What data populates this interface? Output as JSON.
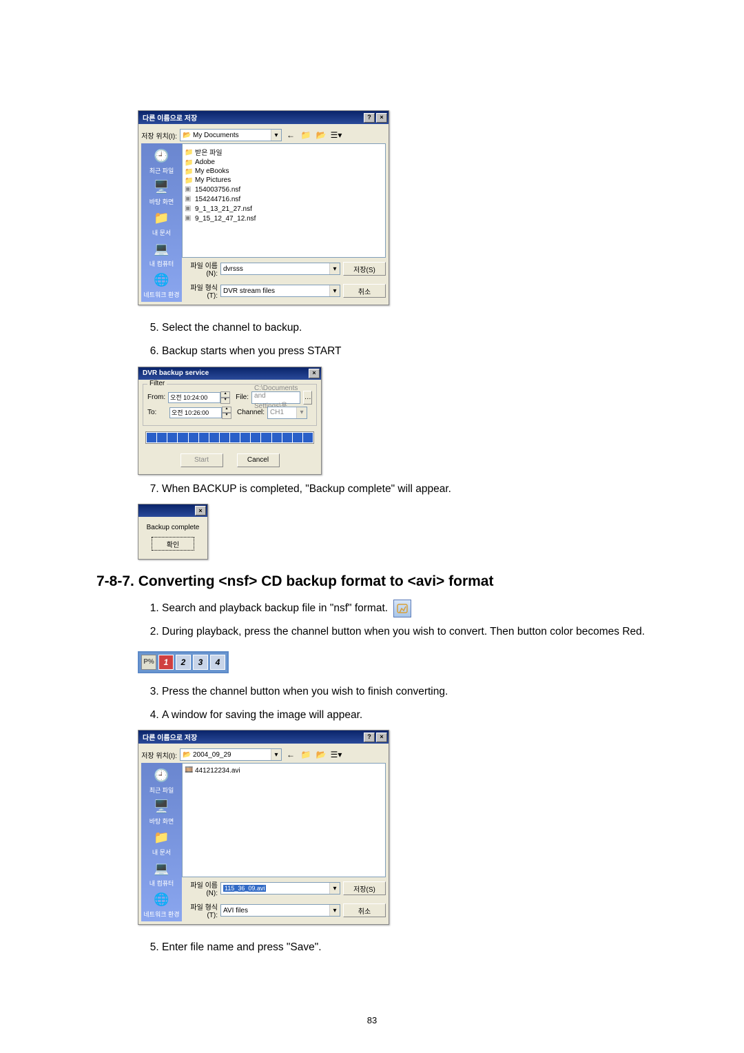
{
  "save_dialog1": {
    "title": "다른 이름으로 저장",
    "help_btn": "?",
    "close_btn": "×",
    "lookin_label": "저장 위치(I):",
    "lookin_value": "My Documents",
    "nav": {
      "recent": "최근 파일",
      "desktop": "바탕 화면",
      "mydocs": "내 문서",
      "mycomp": "내 컴퓨터",
      "network": "네트워크 환경"
    },
    "files": [
      {
        "type": "folder",
        "name": "받은 파일"
      },
      {
        "type": "folder",
        "name": "Adobe"
      },
      {
        "type": "folder",
        "name": "My eBooks"
      },
      {
        "type": "folder",
        "name": "My Pictures"
      },
      {
        "type": "file",
        "name": "154003756.nsf"
      },
      {
        "type": "file",
        "name": "154244716.nsf"
      },
      {
        "type": "file",
        "name": "9_1_13_21_27.nsf"
      },
      {
        "type": "file",
        "name": "9_15_12_47_12.nsf"
      }
    ],
    "filename_label": "파일 이름(N):",
    "filename_value": "dvrsss",
    "filetype_label": "파일 형식(T):",
    "filetype_value": "DVR stream files",
    "save_btn": "저장(S)",
    "cancel_btn": "취소"
  },
  "step5": "Select the channel to backup.",
  "step6": "Backup starts when you press START",
  "backup_service": {
    "title": "DVR backup service",
    "filter_label": "Filter",
    "from_label": "From:",
    "from_value": "오전 10:24:00",
    "to_label": "To:",
    "to_value": "오전 10:26:00",
    "file_label": "File:",
    "file_value": "C:\\Documents and Settings\\용",
    "channel_label": "Channel:",
    "channel_value": "CH1",
    "start_btn": "Start",
    "cancel_btn": "Cancel"
  },
  "step7": "When BACKUP is completed, \"Backup complete\" will appear.",
  "complete_dialog": {
    "text": "Backup complete",
    "ok_btn": "확인"
  },
  "section_heading": "7-8-7. Converting <nsf> CD backup format to <avi> format",
  "convert": {
    "step1": "Search and playback backup file in \"nsf\" format.",
    "step2": "During playback, press the channel button when you wish to convert. Then button color becomes Red.",
    "step3": "Press the channel button when you wish to finish converting.",
    "step4": "A window for saving the image will appear.",
    "step5": "Enter file name and press \"Save\"."
  },
  "channel_bar": {
    "logo": "P%",
    "channels": [
      "1",
      "2",
      "3",
      "4"
    ]
  },
  "save_dialog2": {
    "title": "다른 이름으로 저장",
    "lookin_label": "저장 위치(I):",
    "lookin_value": "2004_09_29",
    "files": [
      {
        "type": "file",
        "name": "441212234.avi"
      }
    ],
    "filename_label": "파일 이름(N):",
    "filename_value": "115_36_09.avi",
    "filetype_label": "파일 형식(T):",
    "filetype_value": "AVI files",
    "save_btn": "저장(S)",
    "cancel_btn": "취소"
  },
  "page_number": "83"
}
